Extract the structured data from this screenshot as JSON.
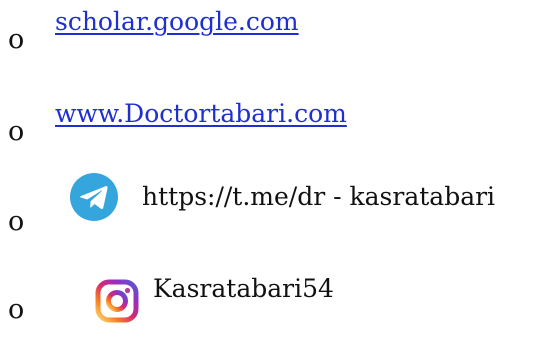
{
  "bullet_glyph": "o",
  "items": [
    {
      "kind": "link",
      "label": "scholar.google.com"
    },
    {
      "kind": "link",
      "label": "www.Doctortabari.com"
    },
    {
      "kind": "text",
      "icon": "telegram-icon",
      "label": "https://t.me/dr - kasratabari"
    },
    {
      "kind": "text",
      "icon": "instagram-icon",
      "label": "Kasratabari54"
    }
  ],
  "colors": {
    "link": "#1f2fd0",
    "telegram": "#35a6dd",
    "instagram_gradient": [
      "#feda75",
      "#fa7e1e",
      "#d62976",
      "#962fbf",
      "#4f5bd5"
    ]
  }
}
